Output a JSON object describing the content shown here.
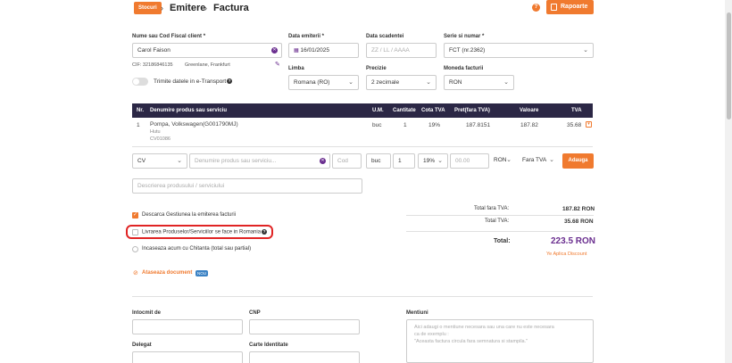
{
  "header": {
    "stocuri_label": "Stocuri",
    "crumb_1": "Emitere",
    "crumb_2": "Factura",
    "sep": "›",
    "help": "?",
    "rapoarte_label": "Rapoarte"
  },
  "client": {
    "label": "Nume sau Cod Fiscal client *",
    "value": "Carol Faison",
    "cif": "CIF: 32186846135",
    "address": "Greenlane, Frankfurt"
  },
  "dates": {
    "emitere_label": "Data emiterii *",
    "emitere_value": "16/01/2025",
    "scadenta_label": "Data scadentei",
    "scadenta_placeholder": "ZZ / LL / AAAA"
  },
  "serie": {
    "label": "Serie si numar *",
    "value": "FCT (nr.2362)"
  },
  "options": {
    "limba_label": "Limba",
    "limba_value": "Romana (RO)",
    "precizie_label": "Precizie",
    "precizie_value": "2 zecimale",
    "moneda_label": "Moneda facturii",
    "moneda_value": "RON",
    "etransport_label": "Trimite datele in e-Transport"
  },
  "table": {
    "headers": [
      "Nr.",
      "Denumire produs sau serviciu",
      "U.M.",
      "Cantitate",
      "Cota TVA",
      "Pret(fara TVA)",
      "Valoare",
      "TVA"
    ],
    "rows": [
      {
        "nr": "1",
        "name": "Pompa, Volkswagen(G001790MJ)",
        "sub1": "Hutu",
        "sub2": "CV01086",
        "um": "buc",
        "qty": "1",
        "cota": "19%",
        "pret": "187.8151",
        "valoare": "187.82",
        "tva": "35.68"
      }
    ]
  },
  "add_row": {
    "code_value": "CV",
    "name_placeholder": "Denumire produs sau serviciu...",
    "cod_placeholder": "Cod",
    "um_value": "buc",
    "qty_value": "1",
    "cota_value": "19%",
    "price_placeholder": "00.00",
    "currency_value": "RON",
    "tva_mode": "Fara TVA",
    "adauga_label": "Adauga",
    "desc_placeholder": "Descrierea produsului / serviciului"
  },
  "checks": {
    "descarca_label": "Descarca Gestiunea la emiterea facturii",
    "livrare_label": "Livrarea Produselor/Serviciilor se face in Romania",
    "incaseaza_label": "Incaseaza acum cu Chitanta (total sau partial)",
    "ataseaza_label": "Ataseaza document",
    "ataseaza_badge": "NOU"
  },
  "totals": {
    "fara_tva_label": "Total fara TVA:",
    "fara_tva_value": "187.82 RON",
    "tva_label": "Total TVA:",
    "tva_value": "35.68 RON",
    "total_label": "Total:",
    "total_value": "223.5 RON",
    "discount_link": "Ye Aplica Discount"
  },
  "bottom": {
    "intocmit_label": "Intocmit de",
    "cnp_label": "CNP",
    "delegat_label": "Delegat",
    "carte_label": "Carte Identitate",
    "mentiuni_label": "Mentiuni",
    "mentiuni_placeholder_1": "Aici adaugi o mentiune necesara sau una care nu este necesara",
    "mentiuni_placeholder_2": "ca de exemplu :",
    "mentiuni_placeholder_3": "\"Aceasta factura circula fara semnatura si stampila.\""
  }
}
